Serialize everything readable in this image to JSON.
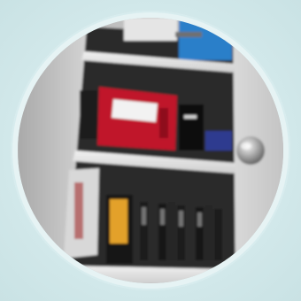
{
  "image": {
    "subject": "cabinet-shelves-photo",
    "colors": {
      "background": "#cfe6e8",
      "ring": "#e6f3f4",
      "shelf": "#e8e8e8",
      "cabinet_side": "#c8c8c8",
      "cabinet_inside": "#2b2b2b",
      "red_box": "#c0172a",
      "blue_box": "#2e3a8f",
      "orange_label": "#e3a12b",
      "blue_top": "#2a7fc9"
    },
    "icons": [
      "knob-icon"
    ]
  }
}
